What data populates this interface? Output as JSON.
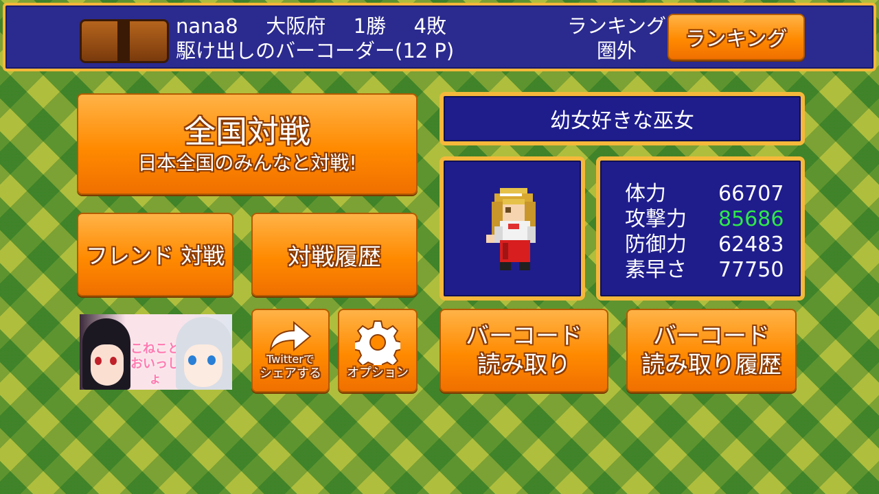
{
  "header": {
    "player_name": "nana8",
    "prefecture": "大阪府",
    "wins": "1勝",
    "losses": "4敗",
    "title_rank": "駆け出しのバーコーダー(12 P)",
    "ranking_label": "ランキング",
    "ranking_value": "圏外",
    "ranking_button": "ランキング"
  },
  "menu": {
    "national_battle_title": "全国対戦",
    "national_battle_sub": "日本全国のみんなと対戦!",
    "friend_battle": "フレンド 対戦",
    "battle_history": "対戦履歴",
    "twitter_share_line1": "Twitterで",
    "twitter_share_line2": "シェアする",
    "options": "オプション",
    "barcode_scan_line1": "バーコード",
    "barcode_scan_line2": "読み取り",
    "barcode_history_line1": "バーコード",
    "barcode_history_line2": "読み取り履歴"
  },
  "character": {
    "name": "幼女好きな巫女",
    "stats": [
      {
        "label": "体力",
        "value": "66707",
        "color": "#ffffff"
      },
      {
        "label": "攻撃力",
        "value": "85686",
        "color": "#2ee84a"
      },
      {
        "label": "防御力",
        "value": "62483",
        "color": "#ffffff"
      },
      {
        "label": "素早さ",
        "value": "77750",
        "color": "#ffffff"
      }
    ]
  },
  "banner": {
    "logo_text": "こねことおいっしょ"
  },
  "colors": {
    "accent_orange": "#ff8a00",
    "panel_blue": "#1f1d8c",
    "border_gold": "#f5b83a",
    "highlight_green": "#2ee84a"
  },
  "icons": {
    "book": "book-icon",
    "share": "share-arrow-icon",
    "options": "gear-icon"
  }
}
